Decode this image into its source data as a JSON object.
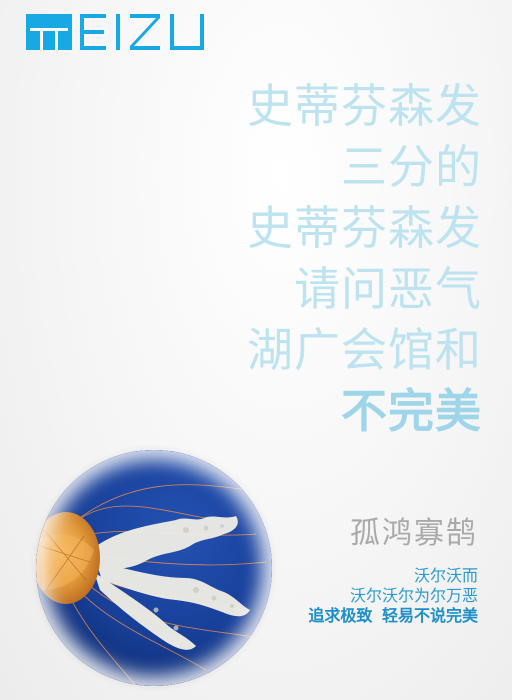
{
  "brand": {
    "logo_text": "MEIZU",
    "logo_color": "#17a9e4"
  },
  "headline": {
    "lines": [
      "史蒂芬森发",
      "三分的",
      "史蒂芬森发",
      "请问恶气",
      "湖广会馆和"
    ],
    "emphasis": "不完美",
    "color": "#bde3f0",
    "emphasis_color": "#9fd5e8"
  },
  "image": {
    "subject": "jellyfish",
    "background_color": "#163c93"
  },
  "subtitle": "孤鸿寡鹄",
  "description": {
    "lines": [
      "沃尔沃而",
      "沃尔沃尔为尔万恶"
    ],
    "slogan": "追求极致  轻易不说完美",
    "color": "#2a9ad0"
  }
}
